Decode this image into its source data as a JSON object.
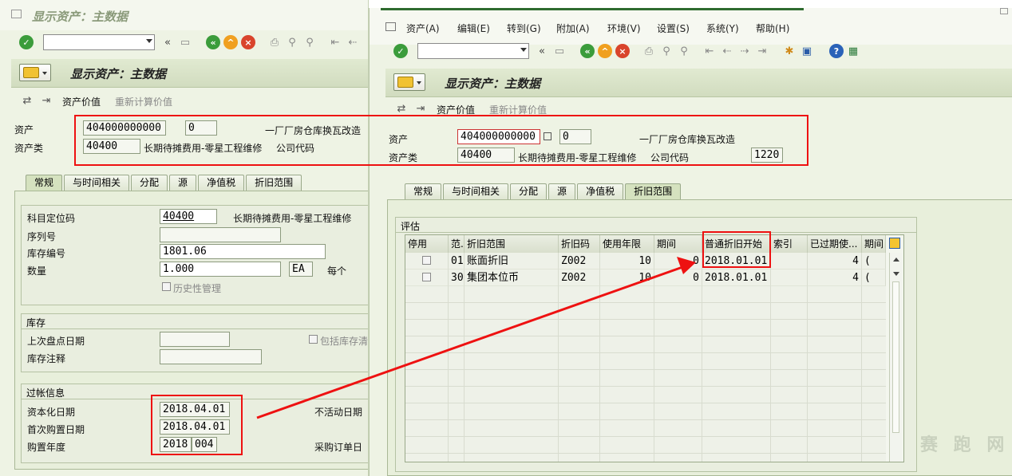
{
  "left": {
    "window_title": "显示资产：主数据",
    "header_title": "显示资产：主数据",
    "subtoolbar": {
      "asset_value": "资产价值",
      "recalc_value": "重新计算价值"
    },
    "fields": {
      "asset_label": "资产",
      "asset_no": "404000000000",
      "sub_no": "0",
      "asset_desc": "一厂厂房仓库换瓦改造",
      "class_label": "资产类",
      "class_value": "40400",
      "class_desc": "长期待摊费用-零星工程维修",
      "company_label": "公司代码"
    },
    "tabs": [
      "常规",
      "与时间相关",
      "分配",
      "源",
      "净值税",
      "折旧范围"
    ],
    "general": {
      "gl_label": "科目定位码",
      "gl_value": "40400",
      "gl_desc": "长期待摊费用-零星工程维修",
      "serial_label": "序列号",
      "serial_value": "",
      "inventory_no_label": "库存编号",
      "inventory_no_value": "1801.06",
      "qty_label": "数量",
      "qty_value": "1.000",
      "unit_value": "EA",
      "per_label": "每个",
      "history_label": "历史性管理"
    },
    "inventory": {
      "title": "库存",
      "last_count_label": "上次盘点日期",
      "include_label": "包括库存清",
      "note_label": "库存注释"
    },
    "posting": {
      "title": "过帐信息",
      "cap_date_label": "资本化日期",
      "cap_date_value": "2018.04.01",
      "first_acq_label": "首次购置日期",
      "first_acq_value": "2018.04.01",
      "acq_year_label": "购置年度",
      "acq_year_value": "2018",
      "acq_period_value": "004",
      "inactive_label": "不活动日期",
      "po_date_label": "采购订单日"
    }
  },
  "right": {
    "menu": [
      "资产(A)",
      "编辑(E)",
      "转到(G)",
      "附加(A)",
      "环境(V)",
      "设置(S)",
      "系统(Y)",
      "帮助(H)"
    ],
    "header_title": "显示资产：主数据",
    "subtoolbar": {
      "asset_value": "资产价值",
      "recalc_value": "重新计算价值"
    },
    "fields": {
      "asset_label": "资产",
      "asset_no": "404000000000",
      "sub_no": "0",
      "asset_desc": "一厂厂房仓库换瓦改造",
      "class_label": "资产类",
      "class_value": "40400",
      "class_desc": "长期待摊费用-零星工程维修",
      "company_label": "公司代码",
      "company_value": "1220"
    },
    "tabs": [
      "常规",
      "与时间相关",
      "分配",
      "源",
      "净值税",
      "折旧范围"
    ],
    "active_tab": "折旧范围",
    "valuation": {
      "title": "评估",
      "columns": [
        "停用",
        "范.",
        "折旧范围",
        "折旧码",
        "使用年限",
        "期间",
        "普通折旧开始",
        "索引",
        "已过期使...",
        "期间"
      ],
      "rows": [
        {
          "area": "01",
          "name": "账面折旧",
          "key": "Z002",
          "life": "10",
          "period": "0",
          "start": "2018.01.01",
          "index": "",
          "expired": "4",
          "exp_period": "("
        },
        {
          "area": "30",
          "name": "集团本位币",
          "key": "Z002",
          "life": "10",
          "period": "0",
          "start": "2018.01.01",
          "index": "",
          "expired": "4",
          "exp_period": "("
        }
      ]
    }
  },
  "watermark": "赛 跑 网"
}
